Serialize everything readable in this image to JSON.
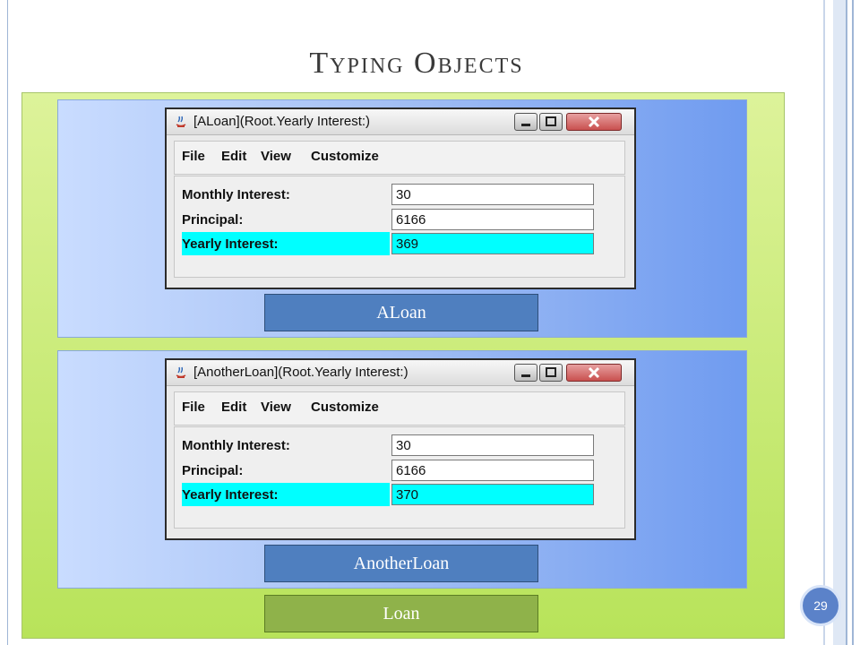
{
  "slide": {
    "title": "Typing Objects",
    "page_number": "29"
  },
  "window1": {
    "title": "[ALoan](Root.Yearly Interest:)",
    "menu": [
      "File",
      "Edit",
      "View",
      "Customize"
    ],
    "fields": [
      {
        "label": "Monthly Interest:",
        "value": "30",
        "highlighted": false
      },
      {
        "label": "Principal:",
        "value": "6166",
        "highlighted": false
      },
      {
        "label": "Yearly Interest:",
        "value": "369",
        "highlighted": true
      }
    ],
    "caption": "ALoan"
  },
  "window2": {
    "title": "[AnotherLoan](Root.Yearly Interest:)",
    "menu": [
      "File",
      "Edit",
      "View",
      "Customize"
    ],
    "fields": [
      {
        "label": "Monthly Interest:",
        "value": "30",
        "highlighted": false
      },
      {
        "label": "Principal:",
        "value": "6166",
        "highlighted": false
      },
      {
        "label": "Yearly Interest:",
        "value": "370",
        "highlighted": true
      }
    ],
    "caption": "AnotherLoan"
  },
  "bottom_caption": "Loan",
  "colors": {
    "highlight": "#00ffff",
    "object_box": "#4f7fbf",
    "class_box": "#8fb24a",
    "outer_panel": "#c8eb7a"
  },
  "icons": [
    "java-app-icon",
    "minimize-icon",
    "maximize-icon",
    "close-icon"
  ]
}
